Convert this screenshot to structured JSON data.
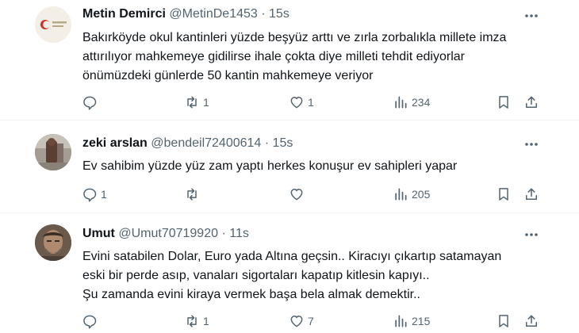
{
  "tweets": [
    {
      "name": "Metin Demirci",
      "handle": "@MetinDe1453",
      "time": "15s",
      "avatar_label": "",
      "avatar_icon": "turkey-flag-crescent-icon",
      "lines": [
        "Bakırköyde okul kantinleri yüzde beşyüz arttı ve zırla zorbalıkla millete imza",
        "attırılıyor mahkemeye gidilirse ihale çokta diye milleti tehdit ediyorlar",
        "önümüzdeki günlerde 50 kantin mahkemeye veriyor"
      ],
      "reply_count": "",
      "retweet_count": "1",
      "like_count": "1",
      "view_count": "234"
    },
    {
      "name": "zeki arslan",
      "handle": "@bendeil72400614",
      "time": "15s",
      "avatar_icon": "user-photo-avatar",
      "lines": [
        "Ev sahibim yüzde yüz zam yaptı herkes konuşur ev sahipleri yapar"
      ],
      "reply_count": "1",
      "retweet_count": "",
      "like_count": "",
      "view_count": "205"
    },
    {
      "name": "Umut",
      "handle": "@Umut70719920",
      "time": "11s",
      "avatar_icon": "user-photo-avatar",
      "lines": [
        "Evini satabilen Dolar, Euro yada Altına geçsin.. Kiracıyı çıkartıp satamayan",
        "eski bir perde asıp, vanaları sigortaları kapatıp kitlesin kapıyı..",
        "Şu zamanda evini kiraya vermek başa bela almak demektir.."
      ],
      "reply_count": "",
      "retweet_count": "1",
      "like_count": "7",
      "view_count": "215"
    }
  ],
  "separator": "·",
  "colors": {
    "text": "#0f1419",
    "secondary": "#536471",
    "divider": "#eff3f4"
  }
}
